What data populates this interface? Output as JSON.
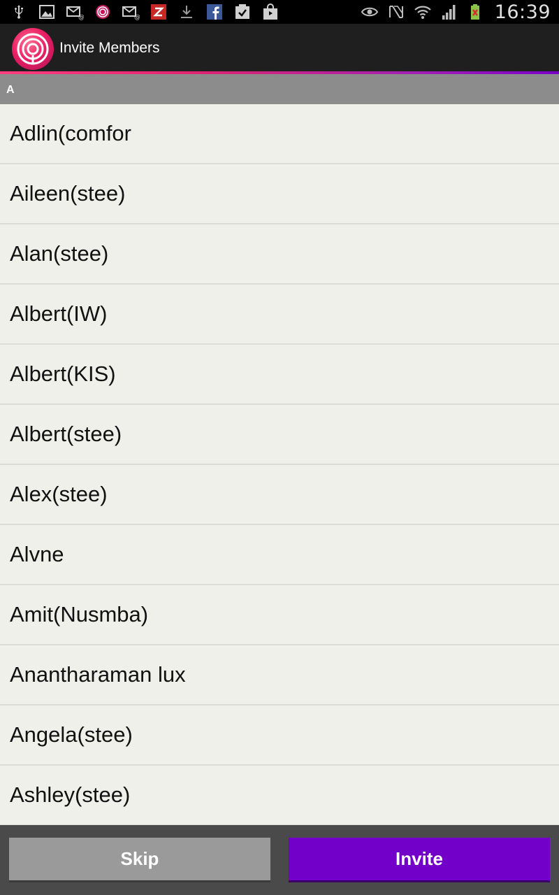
{
  "status_bar": {
    "time": "16:39",
    "left_icons": [
      "usb-icon",
      "gallery-icon",
      "email-icon",
      "app-logo-notification-icon",
      "email-icon",
      "zite-icon",
      "download-icon",
      "facebook-icon",
      "task-check-icon",
      "shopping-bag-icon"
    ],
    "right_icons": [
      "eye-icon",
      "nfc-icon",
      "wifi-icon",
      "signal-icon",
      "battery-icon"
    ]
  },
  "action_bar": {
    "title": "Invite Members",
    "logo_icon": "app-logo-icon"
  },
  "section": {
    "letter": "A"
  },
  "contacts": [
    "Adlin(comfor",
    "Aileen(stee)",
    "Alan(stee)",
    "Albert(IW)",
    "Albert(KIS)",
    "Albert(stee)",
    "Alex(stee)",
    "Alvne",
    "Amit(Nusmba)",
    "Anantharaman lux",
    "Angela(stee)",
    "Ashley(stee)"
  ],
  "buttons": {
    "skip_label": "Skip",
    "invite_label": "Invite"
  },
  "colors": {
    "accent_purple": "#7300c8",
    "accent_pink": "#e0246f",
    "skip_gray": "#9a9a9a",
    "section_header": "#8c8c8c"
  }
}
